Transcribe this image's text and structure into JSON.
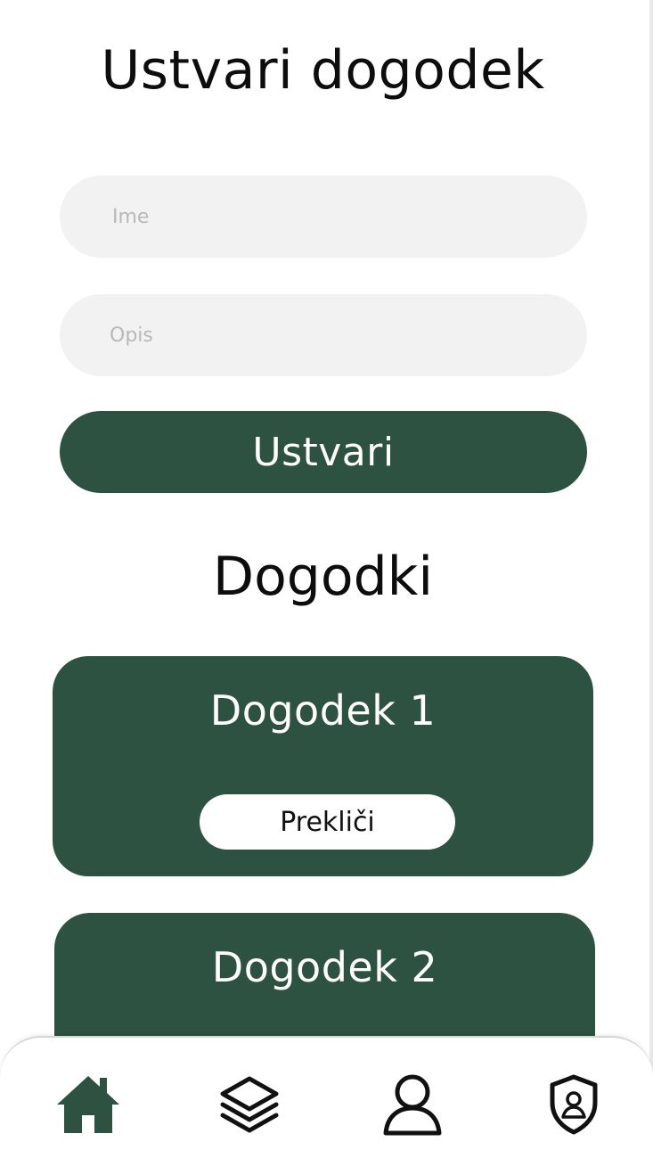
{
  "header": {
    "title": "Ustvari dogodek"
  },
  "form": {
    "name_placeholder": "Ime",
    "description_placeholder": "Opis",
    "create_label": "Ustvari"
  },
  "events_section": {
    "title": "Dogodki",
    "events": [
      {
        "title": "Dogodek 1",
        "cancel_label": "Prekliči"
      },
      {
        "title": "Dogodek 2"
      }
    ]
  },
  "bottom_nav": {
    "items": [
      {
        "icon": "home-icon",
        "active": true
      },
      {
        "icon": "layers-icon",
        "active": false
      },
      {
        "icon": "user-icon",
        "active": false
      },
      {
        "icon": "shield-user-icon",
        "active": false
      }
    ]
  },
  "colors": {
    "accent": "#2d5241",
    "input_background": "#f2f2f2",
    "placeholder": "#b8b8b8"
  }
}
